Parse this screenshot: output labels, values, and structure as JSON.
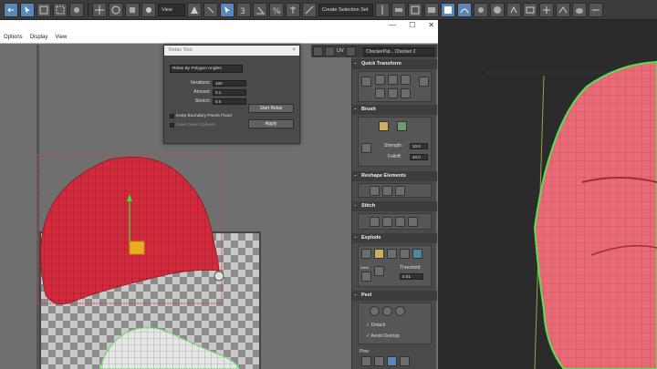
{
  "toolbar": {
    "view_dropdown": "View",
    "selection_set": "Create Selection Set"
  },
  "uv_editor": {
    "menu": [
      "Options",
      "Display",
      "View"
    ],
    "win_minimize": "—",
    "win_maximize": "☐",
    "win_close": "✕",
    "uv_label": "UV",
    "checker_dropdown": "CheckerPat... Checker 2"
  },
  "relax_tool": {
    "title": "Relax Tool",
    "close": "×",
    "method": "Relax By Polygon Angles",
    "iterations_label": "Iterations:",
    "iterations": "100",
    "amount_label": "Amount:",
    "amount": "0.1",
    "stretch_label": "Stretch:",
    "stretch": "0.0",
    "start_button": "Start Relax",
    "keep_boundary": "Keep Boundary Points Fixed",
    "save_outer": "Save Outer Corners",
    "apply_button": "Apply"
  },
  "rollouts": {
    "quick_transform": "Quick Transform",
    "brush": "Brush",
    "strength_label": "Strength:",
    "strength": "10.0",
    "falloff_label": "Falloff:",
    "falloff": "20.0",
    "reshape": "Reshape Elements",
    "stitch": "Stitch",
    "explode": "Explode",
    "threshold_label": "Threshold:",
    "threshold": "0.01",
    "weld_label": "Weld",
    "peel": "Peel",
    "detach": "Detach",
    "avoid_overlap": "Avoid Overlap",
    "pins": "Pins:"
  },
  "colors": {
    "mesh_red": "#e05a68",
    "selection_red": "#c0392b",
    "gizmo_yellow": "#e8b020",
    "accent_blue": "#5b86b8",
    "green_edge": "#58d858"
  }
}
